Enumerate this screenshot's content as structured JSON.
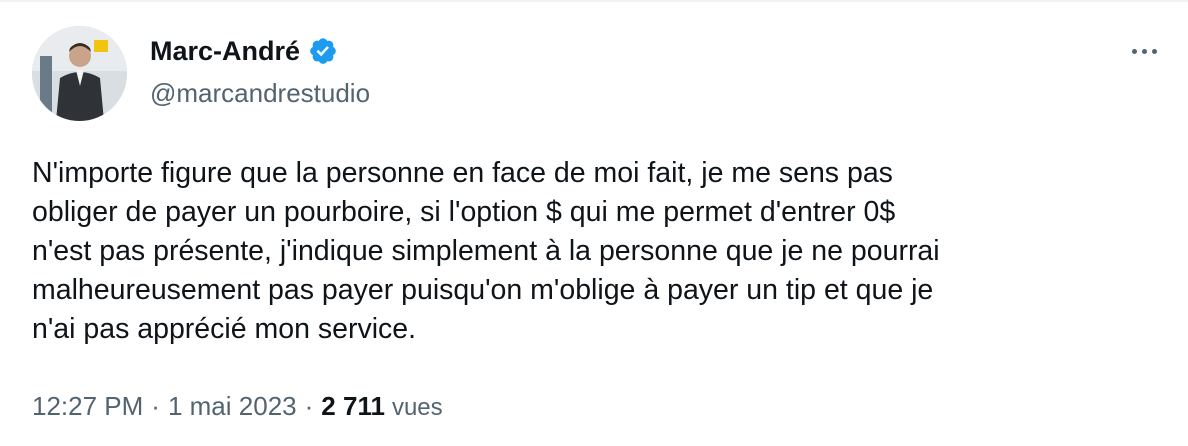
{
  "author": {
    "display_name": "Marc-André",
    "handle": "@marcandrestudio",
    "verified": true,
    "avatar_icon": "profile-photo-avatar"
  },
  "tweet": {
    "text": "N'importe figure que la personne en face de moi fait, je me sens pas\nobliger de payer un pourboire, si l'option $ qui me permet d'entrer 0$\nn'est pas présente, j'indique simplement à la personne que je ne pourrai\nmalheureusement pas payer puisqu'on m'oblige à payer un tip et que je\nn'ai pas apprécié mon service.",
    "time": "12:27 PM",
    "separator": "·",
    "date": "1 mai 2023",
    "views_count": "2 711",
    "views_label": "vues"
  },
  "actions": {
    "more_icon": "more-horizontal-icon"
  },
  "colors": {
    "text_primary": "#0f1419",
    "text_secondary": "#536471",
    "verified_blue": "#1d9bf0"
  }
}
